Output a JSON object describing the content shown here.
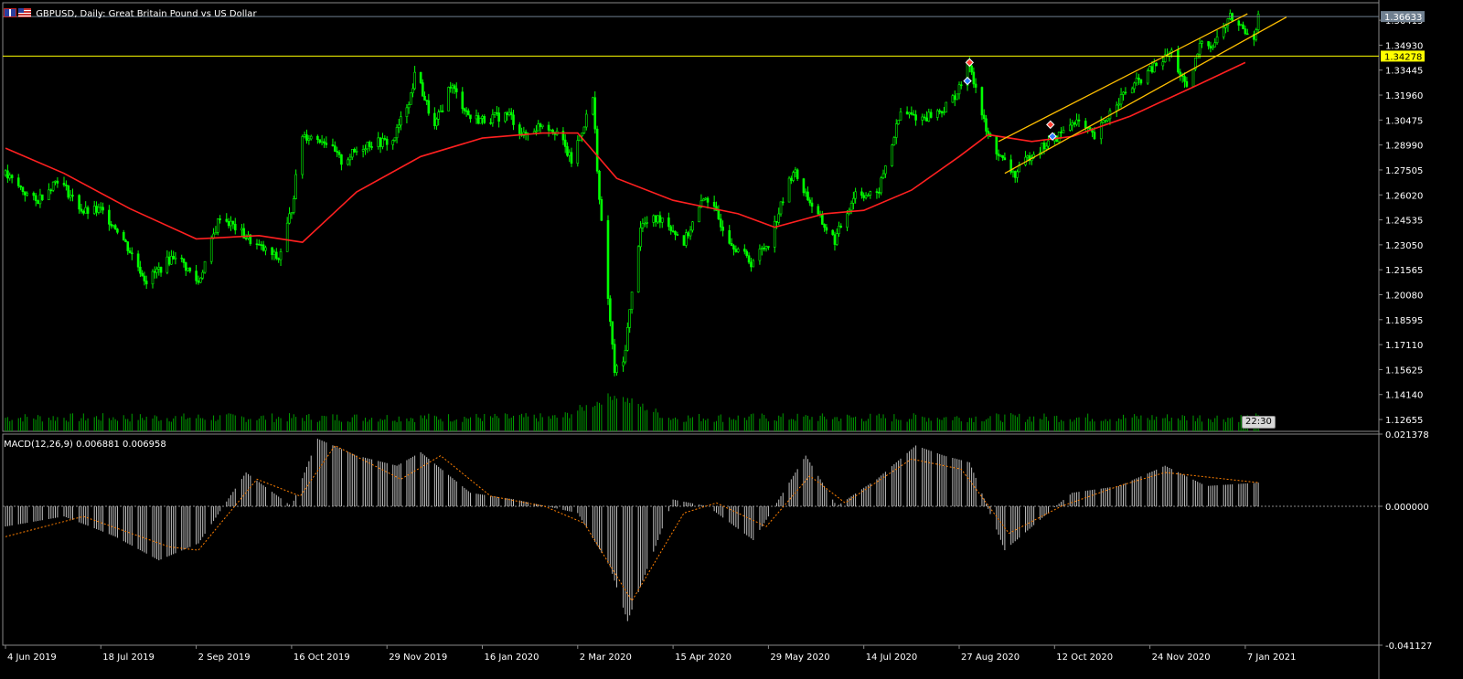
{
  "header": {
    "symbol": "GBPUSD",
    "timeframe": "Daily",
    "description": "Great Britain Pound vs US Dollar",
    "title_text": "GBPUSD, Daily:  Great Britain Pound vs US Dollar"
  },
  "clock": "22:30",
  "colors": {
    "background": "#000000",
    "candle": "#00ff00",
    "ma": "#ff2020",
    "horizontal_line": "#ffff00",
    "channel": "#ffbf00",
    "volume": "#00a000",
    "macd_hist": "#c0c0c0",
    "macd_signal": "#ff7f00",
    "axis_text": "#ffffff"
  },
  "chart_data": [
    {
      "type": "line",
      "name": "price",
      "title": "GBPUSD, Daily:  Great Britain Pound vs US Dollar",
      "ylim": [
        1.1195,
        1.374
      ],
      "yticks": [
        "1.36415",
        "1.34930",
        "1.33445",
        "1.31960",
        "1.30475",
        "1.28990",
        "1.27505",
        "1.26020",
        "1.24535",
        "1.23050",
        "1.21565",
        "1.20080",
        "1.18595",
        "1.17110",
        "1.15625",
        "1.14140",
        "1.12655"
      ],
      "current_price": {
        "value": 1.36633,
        "label": "1.36633"
      },
      "horizontal_level": {
        "value": 1.34278,
        "label": "1.34278"
      },
      "xticks": [
        "4 Jun 2019",
        "18 Jul 2019",
        "2 Sep 2019",
        "16 Oct 2019",
        "29 Nov 2019",
        "16 Jan 2020",
        "2 Mar 2020",
        "15 Apr 2020",
        "29 May 2020",
        "14 Jul 2020",
        "27 Aug 2020",
        "12 Oct 2020",
        "24 Nov 2020",
        "7 Jan 2021"
      ],
      "xtick_dates": [
        "2019-06-04",
        "2019-07-18",
        "2019-09-02",
        "2019-10-16",
        "2019-11-29",
        "2020-01-16",
        "2020-03-02",
        "2020-04-15",
        "2020-05-29",
        "2020-07-14",
        "2020-08-27",
        "2020-10-12",
        "2020-11-24",
        "2021-01-07"
      ],
      "price_path": [
        [
          "2019-06-04",
          1.272
        ],
        [
          "2019-06-18",
          1.256
        ],
        [
          "2019-06-28",
          1.27
        ],
        [
          "2019-07-10",
          1.25
        ],
        [
          "2019-07-18",
          1.251
        ],
        [
          "2019-07-26",
          1.24
        ],
        [
          "2019-08-09",
          1.209
        ],
        [
          "2019-08-23",
          1.225
        ],
        [
          "2019-09-03",
          1.208
        ],
        [
          "2019-09-13",
          1.248
        ],
        [
          "2019-09-30",
          1.23
        ],
        [
          "2019-10-10",
          1.222
        ],
        [
          "2019-10-16",
          1.252
        ],
        [
          "2019-10-21",
          1.296
        ],
        [
          "2019-10-31",
          1.293
        ],
        [
          "2019-11-08",
          1.28
        ],
        [
          "2019-11-20",
          1.291
        ],
        [
          "2019-12-02",
          1.292
        ],
        [
          "2019-12-12",
          1.323
        ],
        [
          "2019-12-13",
          1.335
        ],
        [
          "2019-12-23",
          1.3
        ],
        [
          "2019-12-31",
          1.326
        ],
        [
          "2020-01-10",
          1.306
        ],
        [
          "2020-01-16",
          1.305
        ],
        [
          "2020-01-29",
          1.308
        ],
        [
          "2020-02-05",
          1.295
        ],
        [
          "2020-02-14",
          1.303
        ],
        [
          "2020-02-21",
          1.298
        ],
        [
          "2020-02-28",
          1.28
        ],
        [
          "2020-03-09",
          1.318
        ],
        [
          "2020-03-12",
          1.257
        ],
        [
          "2020-03-19",
          1.155
        ],
        [
          "2020-03-23",
          1.16
        ],
        [
          "2020-03-31",
          1.242
        ],
        [
          "2020-04-10",
          1.247
        ],
        [
          "2020-04-20",
          1.232
        ],
        [
          "2020-04-30",
          1.26
        ],
        [
          "2020-05-12",
          1.232
        ],
        [
          "2020-05-21",
          1.22
        ],
        [
          "2020-05-29",
          1.232
        ],
        [
          "2020-06-10",
          1.275
        ],
        [
          "2020-06-22",
          1.247
        ],
        [
          "2020-06-30",
          1.233
        ],
        [
          "2020-07-10",
          1.262
        ],
        [
          "2020-07-20",
          1.259
        ],
        [
          "2020-07-31",
          1.309
        ],
        [
          "2020-08-10",
          1.306
        ],
        [
          "2020-08-20",
          1.311
        ],
        [
          "2020-08-27",
          1.323
        ],
        [
          "2020-09-01",
          1.339
        ],
        [
          "2020-09-09",
          1.298
        ],
        [
          "2020-09-16",
          1.282
        ],
        [
          "2020-09-23",
          1.272
        ],
        [
          "2020-10-01",
          1.285
        ],
        [
          "2020-10-12",
          1.293
        ],
        [
          "2020-10-21",
          1.305
        ],
        [
          "2020-10-30",
          1.294
        ],
        [
          "2020-11-09",
          1.316
        ],
        [
          "2020-11-24",
          1.334
        ],
        [
          "2020-12-04",
          1.345
        ],
        [
          "2020-12-11",
          1.322
        ],
        [
          "2020-12-18",
          1.353
        ],
        [
          "2020-12-23",
          1.349
        ],
        [
          "2020-12-31",
          1.366
        ],
        [
          "2021-01-07",
          1.358
        ],
        [
          "2021-01-11",
          1.355
        ],
        [
          "2021-01-13",
          1.366
        ]
      ],
      "moving_average": [
        [
          "2019-06-04",
          1.288
        ],
        [
          "2019-07-01",
          1.273
        ],
        [
          "2019-08-01",
          1.252
        ],
        [
          "2019-09-02",
          1.234
        ],
        [
          "2019-10-01",
          1.236
        ],
        [
          "2019-10-21",
          1.232
        ],
        [
          "2019-11-15",
          1.262
        ],
        [
          "2019-12-16",
          1.283
        ],
        [
          "2020-01-16",
          1.294
        ],
        [
          "2020-02-14",
          1.297
        ],
        [
          "2020-03-02",
          1.297
        ],
        [
          "2020-03-20",
          1.27
        ],
        [
          "2020-04-15",
          1.257
        ],
        [
          "2020-05-15",
          1.249
        ],
        [
          "2020-06-01",
          1.241
        ],
        [
          "2020-06-25",
          1.249
        ],
        [
          "2020-07-14",
          1.251
        ],
        [
          "2020-08-05",
          1.263
        ],
        [
          "2020-08-27",
          1.283
        ],
        [
          "2020-09-10",
          1.296
        ],
        [
          "2020-10-01",
          1.292
        ],
        [
          "2020-10-20",
          1.295
        ],
        [
          "2020-11-15",
          1.307
        ],
        [
          "2020-12-15",
          1.325
        ],
        [
          "2021-01-07",
          1.339
        ]
      ],
      "markers": [
        {
          "date": "2020-09-01",
          "value": 1.339,
          "kind": "sell"
        },
        {
          "date": "2020-08-31",
          "value": 1.328,
          "kind": "buy"
        },
        {
          "date": "2020-10-10",
          "value": 1.302,
          "kind": "sell"
        },
        {
          "date": "2020-10-11",
          "value": 1.295,
          "kind": "buy"
        }
      ],
      "channel": {
        "upper": [
          [
            "2020-09-15",
            1.292
          ],
          [
            "2021-01-08",
            1.368
          ]
        ],
        "lower": [
          [
            "2020-09-18",
            1.273
          ],
          [
            "2021-01-26",
            1.366
          ]
        ]
      },
      "volume_peak_date": "2020-03-19"
    },
    {
      "type": "bar",
      "name": "MACD(12,26,9)",
      "header_values": "0.006881 0.006958",
      "ylim": [
        -0.041127,
        0.021378
      ],
      "yticks": [
        "0.021378",
        "0.000000",
        "-0.041127"
      ],
      "histogram_path": [
        [
          "2019-06-04",
          -0.006
        ],
        [
          "2019-07-01",
          -0.003
        ],
        [
          "2019-07-25",
          -0.009
        ],
        [
          "2019-08-15",
          -0.016
        ],
        [
          "2019-09-03",
          -0.011
        ],
        [
          "2019-09-25",
          0.01
        ],
        [
          "2019-10-16",
          0.0
        ],
        [
          "2019-10-28",
          0.02
        ],
        [
          "2019-11-15",
          0.015
        ],
        [
          "2019-12-04",
          0.012
        ],
        [
          "2019-12-16",
          0.016
        ],
        [
          "2020-01-10",
          0.004
        ],
        [
          "2020-02-01",
          0.002
        ],
        [
          "2020-03-02",
          -0.002
        ],
        [
          "2020-03-17",
          -0.018
        ],
        [
          "2020-03-25",
          -0.034
        ],
        [
          "2020-04-15",
          0.002
        ],
        [
          "2020-05-01",
          0.0
        ],
        [
          "2020-05-22",
          -0.01
        ],
        [
          "2020-06-16",
          0.015
        ],
        [
          "2020-07-01",
          0.0
        ],
        [
          "2020-07-20",
          0.008
        ],
        [
          "2020-08-07",
          0.018
        ],
        [
          "2020-08-20",
          0.015
        ],
        [
          "2020-09-01",
          0.013
        ],
        [
          "2020-09-18",
          -0.013
        ],
        [
          "2020-10-05",
          -0.004
        ],
        [
          "2020-10-20",
          0.004
        ],
        [
          "2020-11-10",
          0.006
        ],
        [
          "2020-12-01",
          0.012
        ],
        [
          "2020-12-20",
          0.006
        ],
        [
          "2021-01-13",
          0.007
        ]
      ],
      "signal_path": [
        [
          "2019-06-04",
          -0.009
        ],
        [
          "2019-07-10",
          -0.003
        ],
        [
          "2019-08-20",
          -0.012
        ],
        [
          "2019-09-03",
          -0.013
        ],
        [
          "2019-09-30",
          0.008
        ],
        [
          "2019-10-20",
          0.003
        ],
        [
          "2019-11-05",
          0.018
        ],
        [
          "2019-12-06",
          0.008
        ],
        [
          "2019-12-26",
          0.015
        ],
        [
          "2020-01-20",
          0.003
        ],
        [
          "2020-02-15",
          0.0
        ],
        [
          "2020-03-05",
          -0.005
        ],
        [
          "2020-03-27",
          -0.028
        ],
        [
          "2020-04-20",
          -0.002
        ],
        [
          "2020-05-05",
          0.001
        ],
        [
          "2020-05-28",
          -0.006
        ],
        [
          "2020-06-18",
          0.009
        ],
        [
          "2020-07-05",
          0.001
        ],
        [
          "2020-08-05",
          0.014
        ],
        [
          "2020-08-28",
          0.011
        ],
        [
          "2020-09-20",
          -0.008
        ],
        [
          "2020-10-15",
          0.0
        ],
        [
          "2020-11-10",
          0.006
        ],
        [
          "2020-12-01",
          0.01
        ],
        [
          "2021-01-13",
          0.007
        ]
      ]
    }
  ]
}
